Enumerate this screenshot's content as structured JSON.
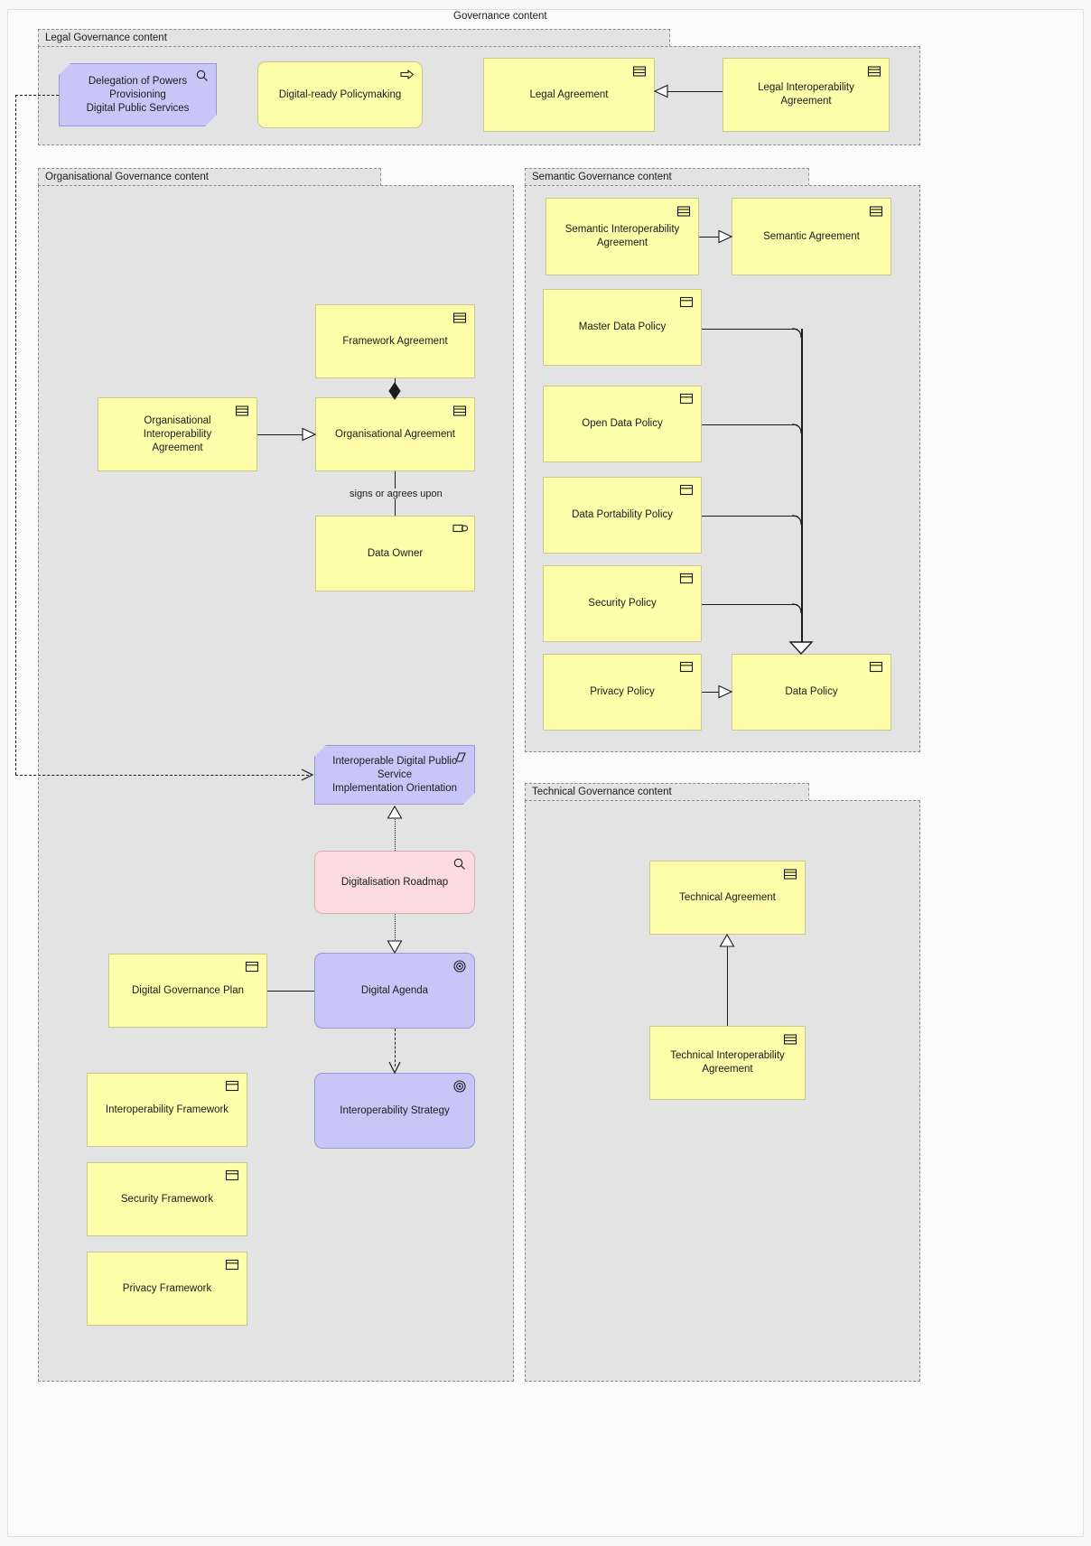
{
  "diagram": {
    "title": "Governance content",
    "background": "#f7f7f7",
    "colors": {
      "group_fill": "#e3e3e3",
      "group_border": "#8c8c8c",
      "outer_fill": "#fbfbfb",
      "yellow_fill": "#fdfdaa",
      "yellow_border": "#c8c88f",
      "purple_fill": "#c8c6f7",
      "purple_border": "#9a98d6",
      "pink_fill": "#fbdbdd",
      "pink_border": "#d8b0b4",
      "line": "#1b1b1b"
    }
  },
  "groups": {
    "legal": "Legal Governance content",
    "organisational": "Organisational Governance content",
    "semantic": "Semantic Governance content",
    "technical": "Technical Governance content"
  },
  "nodes": {
    "delegation_of_powers": {
      "label": "Delegation of Powers Provisioning\nDigital Public Services",
      "icon": "magnifier-icon",
      "type": "assessment"
    },
    "digital_ready_policymaking": {
      "label": "Digital-ready Policymaking",
      "icon": "arrow-right-icon",
      "type": "course-of-action"
    },
    "legal_agreement": {
      "label": "Legal Agreement",
      "icon": "contract-icon",
      "type": "contract"
    },
    "legal_interop_agreement": {
      "label": "Legal Interoperability Agreement",
      "icon": "contract-icon",
      "type": "contract"
    },
    "framework_agreement": {
      "label": "Framework Agreement",
      "icon": "contract-icon",
      "type": "contract"
    },
    "org_interop_agreement": {
      "label": "Organisational Interoperability\nAgreement",
      "icon": "contract-icon",
      "type": "contract"
    },
    "organisational_agreement": {
      "label": "Organisational Agreement",
      "icon": "contract-icon",
      "type": "contract"
    },
    "data_owner": {
      "label": "Data Owner",
      "icon": "business-role-icon",
      "type": "business-role"
    },
    "interoperable_orientation": {
      "label": "Interoperable Digital Public Service\nImplementation Orientation",
      "icon": "principle-icon",
      "type": "principle"
    },
    "digitalisation_roadmap": {
      "label": "Digitalisation Roadmap",
      "icon": "magnifier-icon",
      "type": "assessment"
    },
    "digital_governance_plan": {
      "label": "Digital Governance Plan",
      "icon": "business-object-icon",
      "type": "business-object"
    },
    "digital_agenda": {
      "label": "Digital Agenda",
      "icon": "goal-icon",
      "type": "goal"
    },
    "interoperability_strategy": {
      "label": "Interoperability Strategy",
      "icon": "goal-icon",
      "type": "goal"
    },
    "interoperability_framework": {
      "label": "Interoperability Framework",
      "icon": "business-object-icon",
      "type": "business-object"
    },
    "security_framework": {
      "label": "Security Framework",
      "icon": "business-object-icon",
      "type": "business-object"
    },
    "privacy_framework": {
      "label": "Privacy Framework",
      "icon": "business-object-icon",
      "type": "business-object"
    },
    "semantic_interop_agreement": {
      "label": "Semantic Interoperability\nAgreement",
      "icon": "contract-icon",
      "type": "contract"
    },
    "semantic_agreement": {
      "label": "Semantic Agreement",
      "icon": "contract-icon",
      "type": "contract"
    },
    "master_data_policy": {
      "label": "Master Data Policy",
      "icon": "business-object-icon",
      "type": "business-object"
    },
    "open_data_policy": {
      "label": "Open Data Policy",
      "icon": "business-object-icon",
      "type": "business-object"
    },
    "data_portability_policy": {
      "label": "Data Portability Policy",
      "icon": "business-object-icon",
      "type": "business-object"
    },
    "security_policy": {
      "label": "Security Policy",
      "icon": "business-object-icon",
      "type": "business-object"
    },
    "privacy_policy": {
      "label": "Privacy Policy",
      "icon": "business-object-icon",
      "type": "business-object"
    },
    "data_policy": {
      "label": "Data Policy",
      "icon": "business-object-icon",
      "type": "business-object"
    },
    "technical_agreement": {
      "label": "Technical Agreement",
      "icon": "contract-icon",
      "type": "contract"
    },
    "technical_interop_agreement": {
      "label": "Technical Interoperability\nAgreement",
      "icon": "contract-icon",
      "type": "contract"
    }
  },
  "edge_labels": {
    "signs_or_agrees_upon": "signs or agrees upon"
  },
  "relationships": [
    {
      "from": "legal_interop_agreement",
      "to": "legal_agreement",
      "type": "specialization"
    },
    {
      "from": "org_interop_agreement",
      "to": "organisational_agreement",
      "type": "specialization"
    },
    {
      "from": "framework_agreement",
      "to": "organisational_agreement",
      "type": "composition"
    },
    {
      "from": "organisational_agreement",
      "to": "data_owner",
      "type": "association",
      "label": "signs or agrees upon"
    },
    {
      "from": "delegation_of_powers",
      "to": "interoperable_orientation",
      "type": "influence"
    },
    {
      "from": "digitalisation_roadmap",
      "to": "interoperable_orientation",
      "type": "realization"
    },
    {
      "from": "digitalisation_roadmap",
      "to": "digital_agenda",
      "type": "realization"
    },
    {
      "from": "digital_governance_plan",
      "to": "digital_agenda",
      "type": "association"
    },
    {
      "from": "digital_agenda",
      "to": "interoperability_strategy",
      "type": "influence"
    },
    {
      "from": "semantic_interop_agreement",
      "to": "semantic_agreement",
      "type": "specialization"
    },
    {
      "from": "master_data_policy",
      "to": "data_policy",
      "type": "specialization"
    },
    {
      "from": "open_data_policy",
      "to": "data_policy",
      "type": "specialization"
    },
    {
      "from": "data_portability_policy",
      "to": "data_policy",
      "type": "specialization"
    },
    {
      "from": "security_policy",
      "to": "data_policy",
      "type": "specialization"
    },
    {
      "from": "privacy_policy",
      "to": "data_policy",
      "type": "specialization"
    },
    {
      "from": "technical_interop_agreement",
      "to": "technical_agreement",
      "type": "specialization"
    }
  ]
}
